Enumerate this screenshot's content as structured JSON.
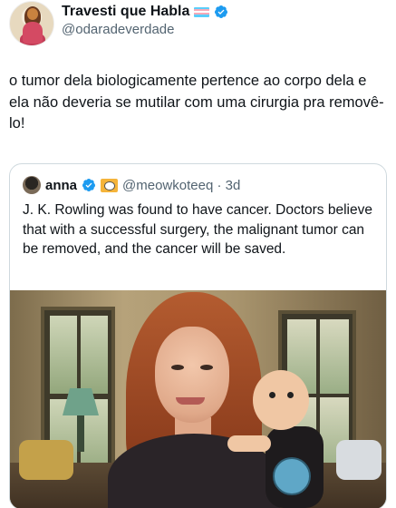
{
  "author": {
    "display_name": "Travesti que Habla",
    "handle": "@odaradeverdade",
    "flag_colors": [
      "#5bcefa",
      "#f5a9b8",
      "#ffffff",
      "#f5a9b8",
      "#5bcefa"
    ],
    "verified": true
  },
  "tweet": {
    "text": "o tumor dela biologicamente pertence ao corpo dela e ela não deveria se mutilar com uma cirurgia pra removê-lo!"
  },
  "quoted": {
    "display_name": "anna",
    "handle_time": "@meowkoteeq · 3d",
    "verified": true,
    "text": "J. K. Rowling was found to have cancer. Doctors believe that with a successful surgery, the malignant tumor can be removed, and the cancer will be saved."
  },
  "colors": {
    "verified_blue": "#1d9bf0",
    "text_primary": "#0f1419",
    "text_secondary": "#536471",
    "border": "#cfd9de"
  },
  "icons": [
    "verified-badge-icon",
    "trans-flag-icon"
  ]
}
